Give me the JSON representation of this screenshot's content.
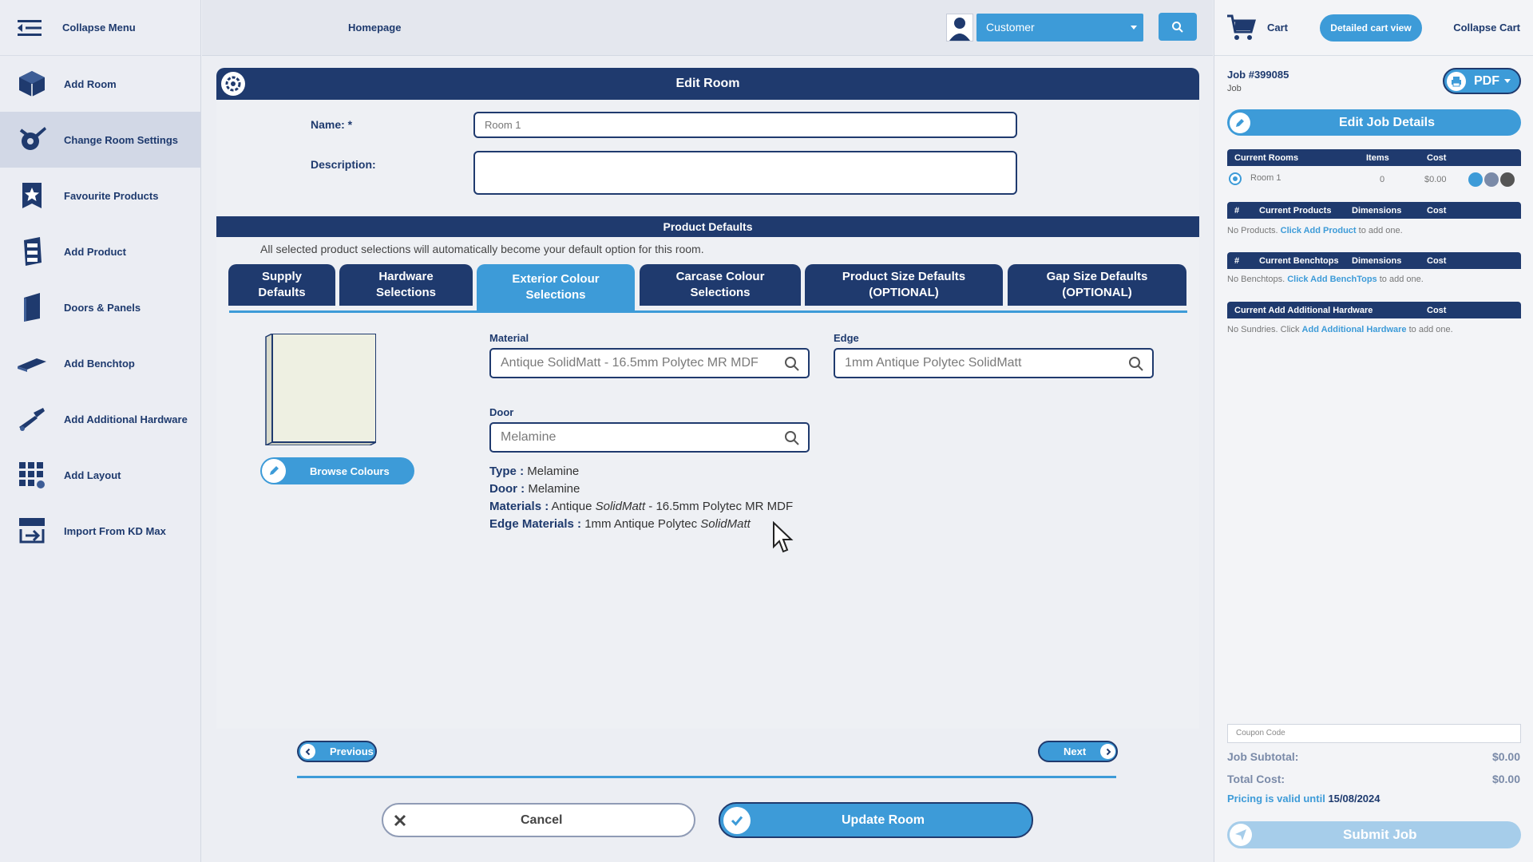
{
  "sidebar": {
    "collapse_label": "Collapse Menu",
    "items": [
      {
        "label": "Add Room",
        "icon": "cube-icon"
      },
      {
        "label": "Change Room Settings",
        "icon": "settings-icon"
      },
      {
        "label": "Favourite Products",
        "icon": "star-icon"
      },
      {
        "label": "Add Product",
        "icon": "cabinet-icon"
      },
      {
        "label": "Doors & Panels",
        "icon": "door-icon"
      },
      {
        "label": "Add Benchtop",
        "icon": "benchtop-icon"
      },
      {
        "label": "Add Additional Hardware",
        "icon": "tools-icon"
      },
      {
        "label": "Add Layout",
        "icon": "grid-icon"
      },
      {
        "label": "Import From KD Max",
        "icon": "import-icon"
      }
    ]
  },
  "topbar": {
    "home_label": "Homepage",
    "customer_select": "Customer"
  },
  "edit_room": {
    "title": "Edit Room",
    "name_label": "Name: *",
    "name_value": "Room 1",
    "description_label": "Description:",
    "description_value": "",
    "product_defaults_title": "Product Defaults",
    "note": "All selected product selections will automatically become your default option for this room.",
    "tabs": [
      {
        "line1": "Supply",
        "line2": "Defaults"
      },
      {
        "line1": "Hardware",
        "line2": "Selections"
      },
      {
        "line1": "Exterior Colour",
        "line2": "Selections"
      },
      {
        "line1": "Carcase Colour",
        "line2": "Selections"
      },
      {
        "line1": "Product Size Defaults",
        "line2": "(OPTIONAL)"
      },
      {
        "line1": "Gap Size Defaults",
        "line2": "(OPTIONAL)"
      }
    ],
    "active_tab": "Exterior Colour Selections",
    "browse_label": "Browse Colours",
    "material_label": "Material",
    "material_value": "Antique SolidMatt - 16.5mm Polytec MR MDF",
    "edge_label": "Edge",
    "edge_value": "1mm Antique Polytec SolidMatt",
    "door_label": "Door",
    "door_value": "Melamine",
    "info": {
      "type_label": "Type :",
      "type_value": "Melamine",
      "door_label": "Door :",
      "door_value": "Melamine",
      "materials_label": "Materials :",
      "materials_value_a": "Antique ",
      "materials_value_b": "SolidMatt",
      "materials_value_c": " - 16.5mm Polytec MR MDF",
      "edge_label": "Edge Materials :",
      "edge_value_a": "1mm Antique Polytec ",
      "edge_value_b": "SolidMatt"
    },
    "previous_label": "Previous",
    "next_label": "Next",
    "cancel_label": "Cancel",
    "update_label": "Update Room"
  },
  "cart": {
    "cart_label": "Cart",
    "detailed_view_label": "Detailed cart view",
    "collapse_label": "Collapse Cart",
    "job_number": "Job #399085",
    "job_sub": "Job",
    "pdf_label": "PDF",
    "edit_job_label": "Edit Job Details",
    "rooms_header": {
      "col1": "Current Rooms",
      "col2": "Items",
      "col3": "Cost"
    },
    "room_row": {
      "name": "Room 1",
      "items": "0",
      "cost": "$0.00"
    },
    "products_header": {
      "hash": "#",
      "col1": "Current Products",
      "col2": "Dimensions",
      "col3": "Cost"
    },
    "products_empty": {
      "a": "No Products. ",
      "link": "Click Add Product",
      "b": " to add one."
    },
    "benchtops_header": {
      "hash": "#",
      "col1": "Current Benchtops",
      "col2": "Dimensions",
      "col3": "Cost"
    },
    "benchtops_empty": {
      "a": "No Benchtops. ",
      "link": "Click Add BenchTops",
      "b": " to add one."
    },
    "hardware_header": {
      "col1": "Current Add Additional Hardware",
      "col3": "Cost"
    },
    "hardware_empty": {
      "a": "No Sundries. Click ",
      "link": "Add Additional Hardware",
      "b": " to add one."
    },
    "coupon_placeholder": "Coupon Code",
    "subtotal_label": "Job Subtotal:",
    "subtotal_value": "$0.00",
    "total_label": "Total Cost:",
    "total_value": "$0.00",
    "valid_label": "Pricing is valid until",
    "valid_date": "15/08/2024",
    "submit_label": "Submit Job"
  },
  "colors": {
    "navy": "#1f3a6e",
    "accent": "#3d9bd8",
    "swatch": "#eef0e2"
  }
}
